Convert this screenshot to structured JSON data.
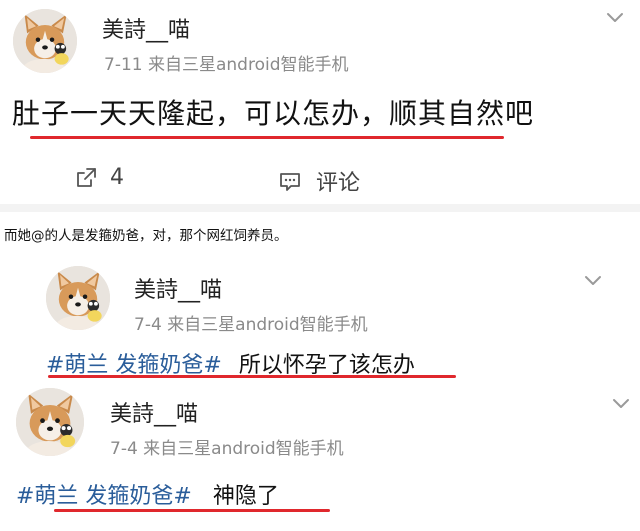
{
  "post": {
    "user": "美詩__喵",
    "meta": "7-11  来自三星android智能手机",
    "text": "肚子一天天隆起，可以怎办，顺其自然吧",
    "share_count": "4",
    "comment_label": "评论"
  },
  "caption": "而她@的人是发箍奶爸，对，那个网红饲养员。",
  "replies": [
    {
      "user": "美詩__喵",
      "meta": "7-4  来自三星android智能手机",
      "tag": "#萌兰 发箍奶爸#",
      "text": "所以怀孕了该怎办"
    },
    {
      "user": "美詩__喵",
      "meta": "7-4  来自三星android智能手机",
      "tag": "#萌兰 发箍奶爸#",
      "text": "神隐了"
    }
  ],
  "colors": {
    "underline": "#e0282d",
    "tag": "#2a5d9a",
    "meta": "#8a8a8a"
  }
}
